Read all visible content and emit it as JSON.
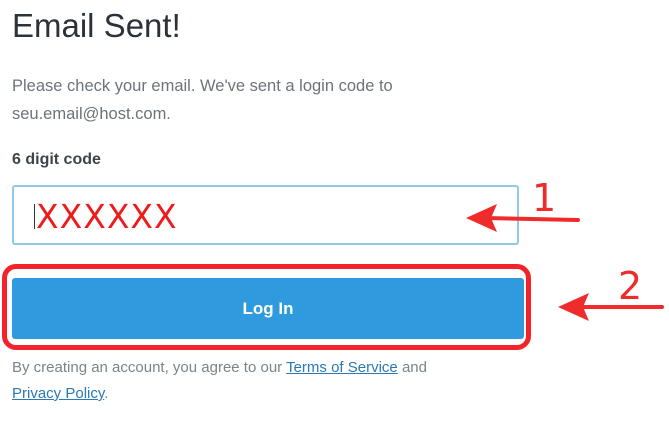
{
  "page": {
    "title": "Email Sent!",
    "message": "Please check your email. We've sent a login code to",
    "email": "seu.email@host.com."
  },
  "form": {
    "code_label": "6 digit code",
    "code_value": "XXXXXX",
    "login_label": "Log In"
  },
  "legal": {
    "prefix": "By creating an account, you agree to our ",
    "terms_link": "Terms of Service",
    "middle": " and",
    "privacy_link": "Privacy Policy",
    "suffix": "."
  },
  "annotations": {
    "step_1": "1",
    "step_2": "2",
    "color": "#ef2b2b"
  },
  "colors": {
    "button": "#2f9bde",
    "input_border": "#8fc9e8",
    "link": "#2a79b5"
  },
  "icons": {
    "arrow_1": "left-arrow-icon",
    "arrow_2": "left-arrow-icon"
  }
}
